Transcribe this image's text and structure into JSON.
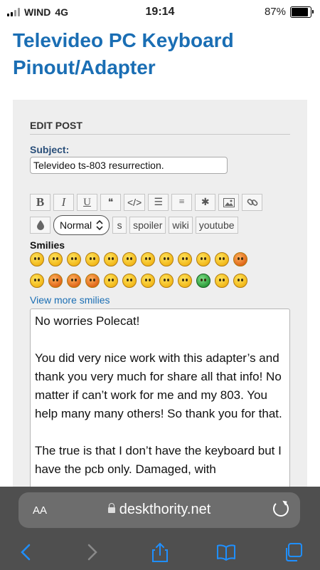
{
  "status_bar": {
    "carrier": "WIND",
    "network": "4G",
    "time": "19:14",
    "battery": "87%",
    "battery_level": 0.87
  },
  "page": {
    "title": "Televideo PC Keyboard Pinout/Adapter"
  },
  "edit_post": {
    "heading": "EDIT POST",
    "subject_label": "Subject:",
    "subject_value": "Televideo ts-803 resurrection.",
    "toolbar": {
      "bold": "B",
      "italic": "I",
      "underline": "U",
      "quote": "❝",
      "code": "</>",
      "list": "☰",
      "list_numbered": "≡",
      "list_item": "✱",
      "image": "🖼",
      "link": "🔗",
      "color": "💧",
      "font_size_value": "Normal",
      "strike": "s",
      "spoiler": "spoiler",
      "wiki": "wiki",
      "youtube": "youtube"
    },
    "smilies_label": "Smilies",
    "view_more_smilies": "View more smilies",
    "message": [
      "No worries Polecat!",
      "You did very nice work with this adapter’s and thank you very much for share all that info! No matter if can’t work for me and my 803. You help many many others! So thank you for that.",
      "The true is that I don’t have the keyboard but I have the pcb only. Damaged, with"
    ]
  },
  "browser": {
    "text_size_label": "AA",
    "url": "deskthority.net",
    "icons": {
      "back": "chevron-left-icon",
      "forward": "chevron-right-icon",
      "share": "share-icon",
      "bookmarks": "book-icon",
      "tabs": "tabs-icon",
      "reload": "reload-icon",
      "lock": "lock-icon"
    },
    "accent_color": "#1f8fff"
  }
}
